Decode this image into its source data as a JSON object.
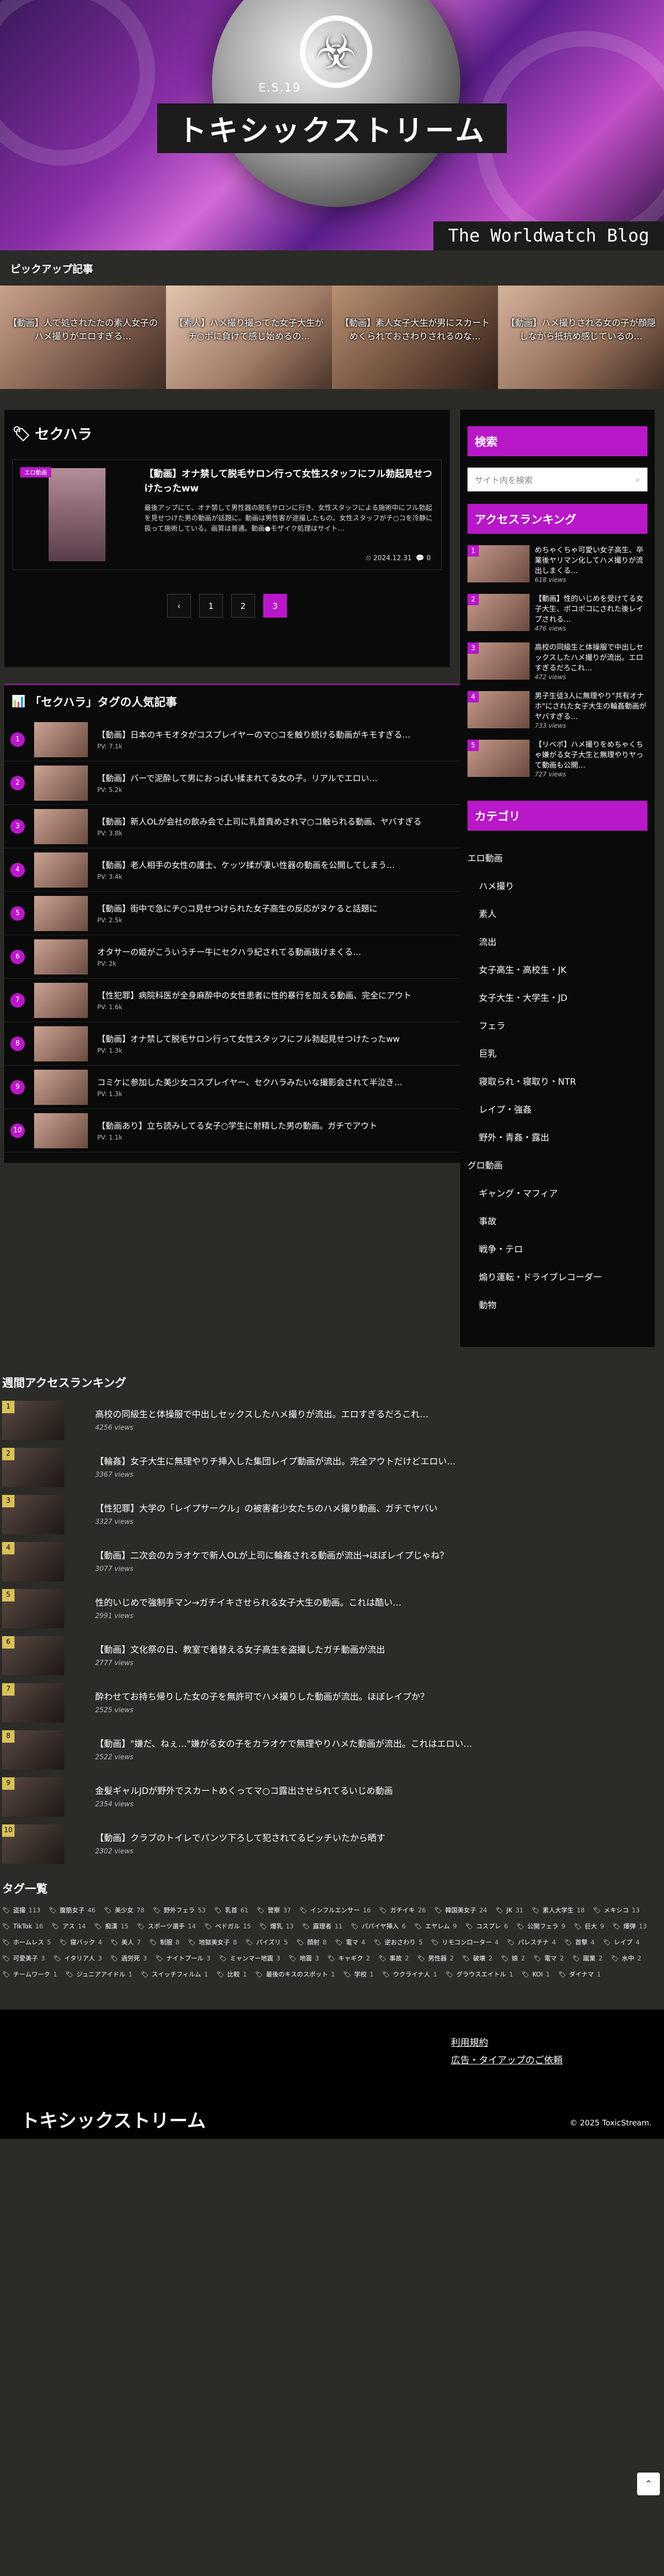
{
  "header": {
    "top_text": "E.S.19",
    "site_title": "トキシックストリーム",
    "blog_title": "The Worldwatch Blog"
  },
  "pickup": {
    "title": "ピックアップ記事",
    "items": [
      "【動画】人で処されたたの素人女子のハメ撮りがエロすぎる…",
      "【素人】ハメ撮り撮ってた女子大生がチ○ポに負けて感じ始めるの…",
      "【動画】素人女子大生が男にスカートめくられておさわりされるのな…",
      "【動画】ハメ撮りされる女の子が顔隠しながら抵抗め感じているの…"
    ]
  },
  "category": {
    "icon": "tag-icon",
    "name": "セクハラ"
  },
  "article": {
    "badge": "エロ動画",
    "title": "【動画】オナ禁して脱毛サロン行って女性スタッフにフル勃起見せつけたったww",
    "excerpt": "最後アップにて、オナ禁して男性器の脱毛サロンに行き、女性スタッフによる施術中にフル勃起を見せつけた男の動画が話題に。動画は男性客が途撮したもの。女性スタッフがチ○コを冷静に扱って施術している。画質は普通。動画●モザイク処理はサイト…",
    "date": "2024.12.31",
    "comments": "0"
  },
  "pager": {
    "prev": "‹",
    "pages": [
      "1",
      "2",
      "3"
    ],
    "current": "3"
  },
  "sidebar": {
    "search_label": "検索",
    "search_placeholder": "サイト内を検索",
    "ranking_label": "アクセスランキング",
    "ranking": [
      {
        "num": "1",
        "title": "めちゃくちゃ可愛い女子高生、卒業後ヤリマン化してハメ撮りが流出しまくる…",
        "views": "618 views"
      },
      {
        "num": "2",
        "title": "【動画】性的いじめを受けてる女子大生、ボコボコにされた後レイプされる…",
        "views": "476 views"
      },
      {
        "num": "3",
        "title": "高校の同級生と体操服で中出しセックスしたハメ撮りが流出。エロすぎるだろこれ…",
        "views": "472 views"
      },
      {
        "num": "4",
        "title": "男子生徒3人に無理やり\"共有オナホ\"にされた女子大生の輪姦動画がヤバすぎる…",
        "views": "733 views"
      },
      {
        "num": "5",
        "title": "【リベポ】ハメ撮りをめちゃくちゃ嫌がる女子大生と無理やりヤって動画も公開…",
        "views": "727 views"
      }
    ],
    "category_label": "カテゴリ",
    "categories": [
      {
        "name": "エロ動画",
        "child": false
      },
      {
        "name": "ハメ撮り",
        "child": true
      },
      {
        "name": "素人",
        "child": true
      },
      {
        "name": "流出",
        "child": true
      },
      {
        "name": "女子高生・高校生・JK",
        "child": true
      },
      {
        "name": "女子大生・大学生・JD",
        "child": true
      },
      {
        "name": "フェラ",
        "child": true
      },
      {
        "name": "巨乳",
        "child": true
      },
      {
        "name": "寝取られ・寝取り・NTR",
        "child": true
      },
      {
        "name": "レイプ・強姦",
        "child": true
      },
      {
        "name": "野外・青姦・露出",
        "child": true
      },
      {
        "name": "グロ動画",
        "child": false
      },
      {
        "name": "ギャング・マフィア",
        "child": true
      },
      {
        "name": "事故",
        "child": true
      },
      {
        "name": "戦争・テロ",
        "child": true
      },
      {
        "name": "煽り運転・ドライブレコーダー",
        "child": true
      },
      {
        "name": "動物",
        "child": true
      }
    ]
  },
  "popular": {
    "title": "「セクハラ」タグの人気記事",
    "items": [
      {
        "num": "1",
        "title": "【動画】日本のキモオタがコスプレイヤーのマ○コを触り続ける動画がキモすぎる…",
        "pv": "PV: 7.1k"
      },
      {
        "num": "2",
        "title": "【動画】バーで泥酔して男におっぱい揉まれてる女の子。リアルでエロい…",
        "pv": "PV: 5.2k"
      },
      {
        "num": "3",
        "title": "【動画】新人OLが会社の飲み会で上司に乳首責めされマ○コ触られる動画、ヤバすぎる",
        "pv": "PV: 3.8k"
      },
      {
        "num": "4",
        "title": "【動画】老人相手の女性の護士、ケッツ揉が凄い性器の動画を公開してしまう…",
        "pv": "PV: 3.4k"
      },
      {
        "num": "5",
        "title": "【動画】街中で急にチ○コ見せつけられた女子高生の反応がヌケると話題に",
        "pv": "PV: 2.5k"
      },
      {
        "num": "6",
        "title": "オタサーの姫がこういうチー牛にセクハラ紀されてる動画抜けまくる…",
        "pv": "PV: 2k"
      },
      {
        "num": "7",
        "title": "【性犯罪】病院科医が全身麻酔中の女性患者に性的暴行を加える動画、完全にアウト",
        "pv": "PV: 1.6k"
      },
      {
        "num": "8",
        "title": "【動画】オナ禁して脱毛サロン行って女性スタッフにフル勃起見せつけたったww",
        "pv": "PV: 1.3k"
      },
      {
        "num": "9",
        "title": "コミケに参加した美少女コスプレイヤー、セクハラみたいな撮影会されて半泣き…",
        "pv": "PV: 1.3k"
      },
      {
        "num": "10",
        "title": "【動画あり】立ち読みしてる女子○学生に射精した男の動画。ガチでアウト",
        "pv": "PV: 1.1k"
      }
    ]
  },
  "weekly": {
    "title": "週間アクセスランキング",
    "items": [
      {
        "num": "1",
        "title": "高校の同級生と体操服で中出しセックスしたハメ撮りが流出。エロすぎるだろこれ…",
        "views": "4256 views"
      },
      {
        "num": "2",
        "title": "【輪姦】女子大生に無理やりチ挿入した集団レイプ動画が流出。完全アウトだけどエロい…",
        "views": "3367 views"
      },
      {
        "num": "3",
        "title": "【性犯罪】大学の「レイプサークル」の被害者少女たちのハメ撮り動画、ガチでヤバい",
        "views": "3327 views"
      },
      {
        "num": "4",
        "title": "【動画】二次会のカラオケで新人OLが上司に輪姦される動画が流出→ほぼレイプじゃね？",
        "views": "3077 views"
      },
      {
        "num": "5",
        "title": "性的いじめで強制手マン→ガチイキさせられる女子大生の動画。これは酷い…",
        "views": "2991 views"
      },
      {
        "num": "6",
        "title": "【動画】文化祭の日、教室で着替える女子高生を盗撮したガチ動画が流出",
        "views": "2777 views"
      },
      {
        "num": "7",
        "title": "酔わせてお持ち帰りした女の子を無許可でハメ撮りした動画が流出。ほぼレイプか？",
        "views": "2525 views"
      },
      {
        "num": "8",
        "title": "【動画】\"嫌だ、ねぇ…\"嫌がる女の子をカラオケで無理やりハメた動画が流出。これはエロい…",
        "views": "2522 views"
      },
      {
        "num": "9",
        "title": "金髪ギャルJDが野外でスカートめくってマ○コ露出させられてるいじめ動画",
        "views": "2354 views"
      },
      {
        "num": "10",
        "title": "【動画】クラブのトイレでパンツ下ろして犯されてるビッチいたから晒す",
        "views": "2302 views"
      }
    ]
  },
  "tags": {
    "title": "タグ一覧",
    "items": [
      {
        "n": "盗撮",
        "c": "113"
      },
      {
        "n": "腹筋女子",
        "c": "46"
      },
      {
        "n": "美少女",
        "c": "78"
      },
      {
        "n": "野外フェラ",
        "c": "53"
      },
      {
        "n": "乳首",
        "c": "61"
      },
      {
        "n": "警察",
        "c": "37"
      },
      {
        "n": "インフルエンサー",
        "c": "16"
      },
      {
        "n": "ガチイキ",
        "c": "26"
      },
      {
        "n": "韓国美女子",
        "c": "24"
      },
      {
        "n": "JK",
        "c": "31"
      },
      {
        "n": "素人大学生",
        "c": "18"
      },
      {
        "n": "メキシコ",
        "c": "13"
      },
      {
        "n": "TikTok",
        "c": "16"
      },
      {
        "n": "アス",
        "c": "14"
      },
      {
        "n": "痴漢",
        "c": "15"
      },
      {
        "n": "スポーツ選手",
        "c": "14"
      },
      {
        "n": "ペドガル",
        "c": "15"
      },
      {
        "n": "爆乳",
        "c": "13"
      },
      {
        "n": "露理者",
        "c": "11"
      },
      {
        "n": "パパイヤ挿入",
        "c": "6"
      },
      {
        "n": "エヤレム",
        "c": "9"
      },
      {
        "n": "コスプレ",
        "c": "6"
      },
      {
        "n": "公開フェラ",
        "c": "9"
      },
      {
        "n": "巨大",
        "c": "9"
      },
      {
        "n": "爆弾",
        "c": "13"
      },
      {
        "n": "ホームレス",
        "c": "5"
      },
      {
        "n": "寝バック",
        "c": "4"
      },
      {
        "n": "美人",
        "c": "7"
      },
      {
        "n": "制服",
        "c": "8"
      },
      {
        "n": "地獄美女子",
        "c": "8"
      },
      {
        "n": "パイズリ",
        "c": "5"
      },
      {
        "n": "顔射",
        "c": "8"
      },
      {
        "n": "電マ",
        "c": "4"
      },
      {
        "n": "逆おさわり",
        "c": "5"
      },
      {
        "n": "リモコンローター",
        "c": "4"
      },
      {
        "n": "パレスチナ",
        "c": "4"
      },
      {
        "n": "首撃",
        "c": "4"
      },
      {
        "n": "レイプ",
        "c": "4"
      },
      {
        "n": "可愛美子",
        "c": "3"
      },
      {
        "n": "イタリア人",
        "c": "3"
      },
      {
        "n": "過労死",
        "c": "3"
      },
      {
        "n": "ナイトプール",
        "c": "3"
      },
      {
        "n": "ミャンマー地震",
        "c": "3"
      },
      {
        "n": "地震",
        "c": "3"
      },
      {
        "n": "キャギク",
        "c": "2"
      },
      {
        "n": "事故",
        "c": "2"
      },
      {
        "n": "男性器",
        "c": "2"
      },
      {
        "n": "破壊",
        "c": "2"
      },
      {
        "n": "娘",
        "c": "2"
      },
      {
        "n": "電マ",
        "c": "2"
      },
      {
        "n": "蹴業",
        "c": "2"
      },
      {
        "n": "水中",
        "c": "2"
      },
      {
        "n": "チームワーク",
        "c": "1"
      },
      {
        "n": "ジュニアアイドル",
        "c": "1"
      },
      {
        "n": "スイッチフィルム",
        "c": "1"
      },
      {
        "n": "比較",
        "c": "1"
      },
      {
        "n": "最後のキスのスポット",
        "c": "1"
      },
      {
        "n": "学校",
        "c": "1"
      },
      {
        "n": "ウクライナ人",
        "c": "1"
      },
      {
        "n": "グラウスエイトル",
        "c": "1"
      },
      {
        "n": "KOI",
        "c": "1"
      },
      {
        "n": "ダイナマ",
        "c": "1"
      }
    ]
  },
  "footer": {
    "links": [
      "利用規約",
      "広告・タイアップのご依頼"
    ],
    "title": "トキシックストリーム",
    "copyright": "© 2025 ToxicStream."
  },
  "colors": {
    "accent": "#b818c7",
    "bg": "#2b2b27",
    "panel": "#0a0a0a"
  }
}
